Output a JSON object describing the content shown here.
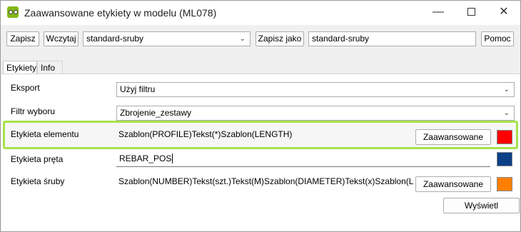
{
  "window": {
    "title": "Zaawansowane etykiety w modelu (ML078)",
    "controls": {
      "minimize": "—",
      "maximize": "",
      "close": "✕"
    }
  },
  "toolbar": {
    "save_label": "Zapisz",
    "load_label": "Wczytaj",
    "preset_value": "standard-sruby",
    "save_as_label": "Zapisz jako",
    "save_as_name": "standard-sruby",
    "help_label": "Pomoc"
  },
  "tabs": [
    {
      "label": "Etykiety",
      "active": true
    },
    {
      "label": "Info",
      "active": false
    }
  ],
  "rows": {
    "export": {
      "label": "Eksport",
      "value": "Użyj filtru"
    },
    "filter": {
      "label": "Filtr wyboru",
      "value": "Zbrojenie_zestawy"
    },
    "element": {
      "label": "Etykieta elementu",
      "value": "Szablon(PROFILE)Tekst(*)Szablon(LENGTH)",
      "button": "Zaawansowane",
      "color": "#ff0000"
    },
    "rebar": {
      "label": "Etykieta pręta",
      "value": "REBAR_POS",
      "color": "#0b3f86"
    },
    "bolt": {
      "label": "Etykieta śruby",
      "value": "Szablon(NUMBER)Tekst(szt.)Tekst(M)Szablon(DIAMETER)Tekst(x)Szablon(LENGTH)",
      "button": "Zaawansowane",
      "color": "#ff8000"
    }
  },
  "show_label": "Wyświetl"
}
